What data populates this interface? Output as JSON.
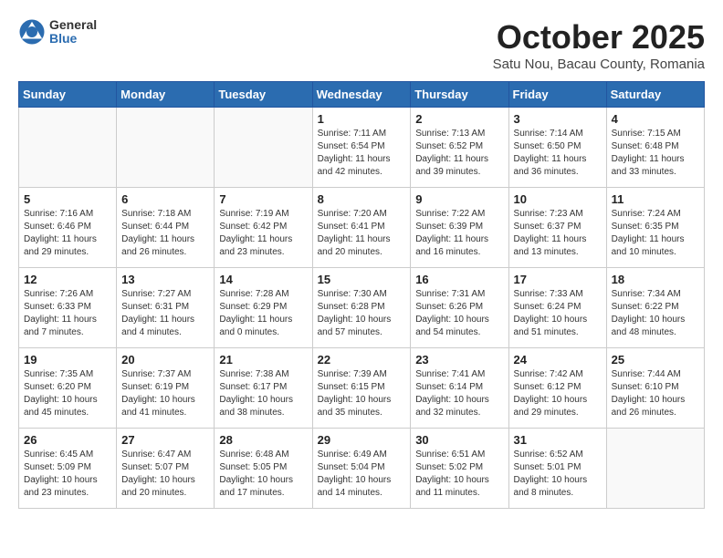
{
  "header": {
    "logo_general": "General",
    "logo_blue": "Blue",
    "month_title": "October 2025",
    "location": "Satu Nou, Bacau County, Romania"
  },
  "days_of_week": [
    "Sunday",
    "Monday",
    "Tuesday",
    "Wednesday",
    "Thursday",
    "Friday",
    "Saturday"
  ],
  "weeks": [
    [
      {
        "day": "",
        "info": ""
      },
      {
        "day": "",
        "info": ""
      },
      {
        "day": "",
        "info": ""
      },
      {
        "day": "1",
        "info": "Sunrise: 7:11 AM\nSunset: 6:54 PM\nDaylight: 11 hours and 42 minutes."
      },
      {
        "day": "2",
        "info": "Sunrise: 7:13 AM\nSunset: 6:52 PM\nDaylight: 11 hours and 39 minutes."
      },
      {
        "day": "3",
        "info": "Sunrise: 7:14 AM\nSunset: 6:50 PM\nDaylight: 11 hours and 36 minutes."
      },
      {
        "day": "4",
        "info": "Sunrise: 7:15 AM\nSunset: 6:48 PM\nDaylight: 11 hours and 33 minutes."
      }
    ],
    [
      {
        "day": "5",
        "info": "Sunrise: 7:16 AM\nSunset: 6:46 PM\nDaylight: 11 hours and 29 minutes."
      },
      {
        "day": "6",
        "info": "Sunrise: 7:18 AM\nSunset: 6:44 PM\nDaylight: 11 hours and 26 minutes."
      },
      {
        "day": "7",
        "info": "Sunrise: 7:19 AM\nSunset: 6:42 PM\nDaylight: 11 hours and 23 minutes."
      },
      {
        "day": "8",
        "info": "Sunrise: 7:20 AM\nSunset: 6:41 PM\nDaylight: 11 hours and 20 minutes."
      },
      {
        "day": "9",
        "info": "Sunrise: 7:22 AM\nSunset: 6:39 PM\nDaylight: 11 hours and 16 minutes."
      },
      {
        "day": "10",
        "info": "Sunrise: 7:23 AM\nSunset: 6:37 PM\nDaylight: 11 hours and 13 minutes."
      },
      {
        "day": "11",
        "info": "Sunrise: 7:24 AM\nSunset: 6:35 PM\nDaylight: 11 hours and 10 minutes."
      }
    ],
    [
      {
        "day": "12",
        "info": "Sunrise: 7:26 AM\nSunset: 6:33 PM\nDaylight: 11 hours and 7 minutes."
      },
      {
        "day": "13",
        "info": "Sunrise: 7:27 AM\nSunset: 6:31 PM\nDaylight: 11 hours and 4 minutes."
      },
      {
        "day": "14",
        "info": "Sunrise: 7:28 AM\nSunset: 6:29 PM\nDaylight: 11 hours and 0 minutes."
      },
      {
        "day": "15",
        "info": "Sunrise: 7:30 AM\nSunset: 6:28 PM\nDaylight: 10 hours and 57 minutes."
      },
      {
        "day": "16",
        "info": "Sunrise: 7:31 AM\nSunset: 6:26 PM\nDaylight: 10 hours and 54 minutes."
      },
      {
        "day": "17",
        "info": "Sunrise: 7:33 AM\nSunset: 6:24 PM\nDaylight: 10 hours and 51 minutes."
      },
      {
        "day": "18",
        "info": "Sunrise: 7:34 AM\nSunset: 6:22 PM\nDaylight: 10 hours and 48 minutes."
      }
    ],
    [
      {
        "day": "19",
        "info": "Sunrise: 7:35 AM\nSunset: 6:20 PM\nDaylight: 10 hours and 45 minutes."
      },
      {
        "day": "20",
        "info": "Sunrise: 7:37 AM\nSunset: 6:19 PM\nDaylight: 10 hours and 41 minutes."
      },
      {
        "day": "21",
        "info": "Sunrise: 7:38 AM\nSunset: 6:17 PM\nDaylight: 10 hours and 38 minutes."
      },
      {
        "day": "22",
        "info": "Sunrise: 7:39 AM\nSunset: 6:15 PM\nDaylight: 10 hours and 35 minutes."
      },
      {
        "day": "23",
        "info": "Sunrise: 7:41 AM\nSunset: 6:14 PM\nDaylight: 10 hours and 32 minutes."
      },
      {
        "day": "24",
        "info": "Sunrise: 7:42 AM\nSunset: 6:12 PM\nDaylight: 10 hours and 29 minutes."
      },
      {
        "day": "25",
        "info": "Sunrise: 7:44 AM\nSunset: 6:10 PM\nDaylight: 10 hours and 26 minutes."
      }
    ],
    [
      {
        "day": "26",
        "info": "Sunrise: 6:45 AM\nSunset: 5:09 PM\nDaylight: 10 hours and 23 minutes."
      },
      {
        "day": "27",
        "info": "Sunrise: 6:47 AM\nSunset: 5:07 PM\nDaylight: 10 hours and 20 minutes."
      },
      {
        "day": "28",
        "info": "Sunrise: 6:48 AM\nSunset: 5:05 PM\nDaylight: 10 hours and 17 minutes."
      },
      {
        "day": "29",
        "info": "Sunrise: 6:49 AM\nSunset: 5:04 PM\nDaylight: 10 hours and 14 minutes."
      },
      {
        "day": "30",
        "info": "Sunrise: 6:51 AM\nSunset: 5:02 PM\nDaylight: 10 hours and 11 minutes."
      },
      {
        "day": "31",
        "info": "Sunrise: 6:52 AM\nSunset: 5:01 PM\nDaylight: 10 hours and 8 minutes."
      },
      {
        "day": "",
        "info": ""
      }
    ]
  ]
}
